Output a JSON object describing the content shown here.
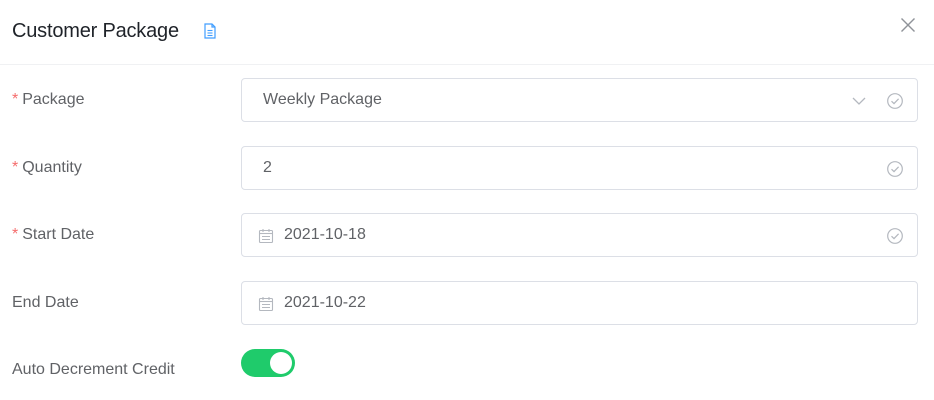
{
  "dialog": {
    "title": "Customer Package",
    "icons": {
      "title_icon": "document-icon",
      "close": "close-icon"
    }
  },
  "form": {
    "package": {
      "label": "Package",
      "required": "*",
      "value": "Weekly Package"
    },
    "quantity": {
      "label": "Quantity",
      "required": "*",
      "value": "2"
    },
    "start_date": {
      "label": "Start Date",
      "required": "*",
      "value": "2021-10-18"
    },
    "end_date": {
      "label": "End Date",
      "value": "2021-10-22"
    },
    "auto_decrement": {
      "label": "Auto Decrement Credit",
      "enabled": true
    }
  },
  "colors": {
    "required": "#f56c6c",
    "toggle_on": "#1fcb6b",
    "accent_icon": "#409eff"
  }
}
